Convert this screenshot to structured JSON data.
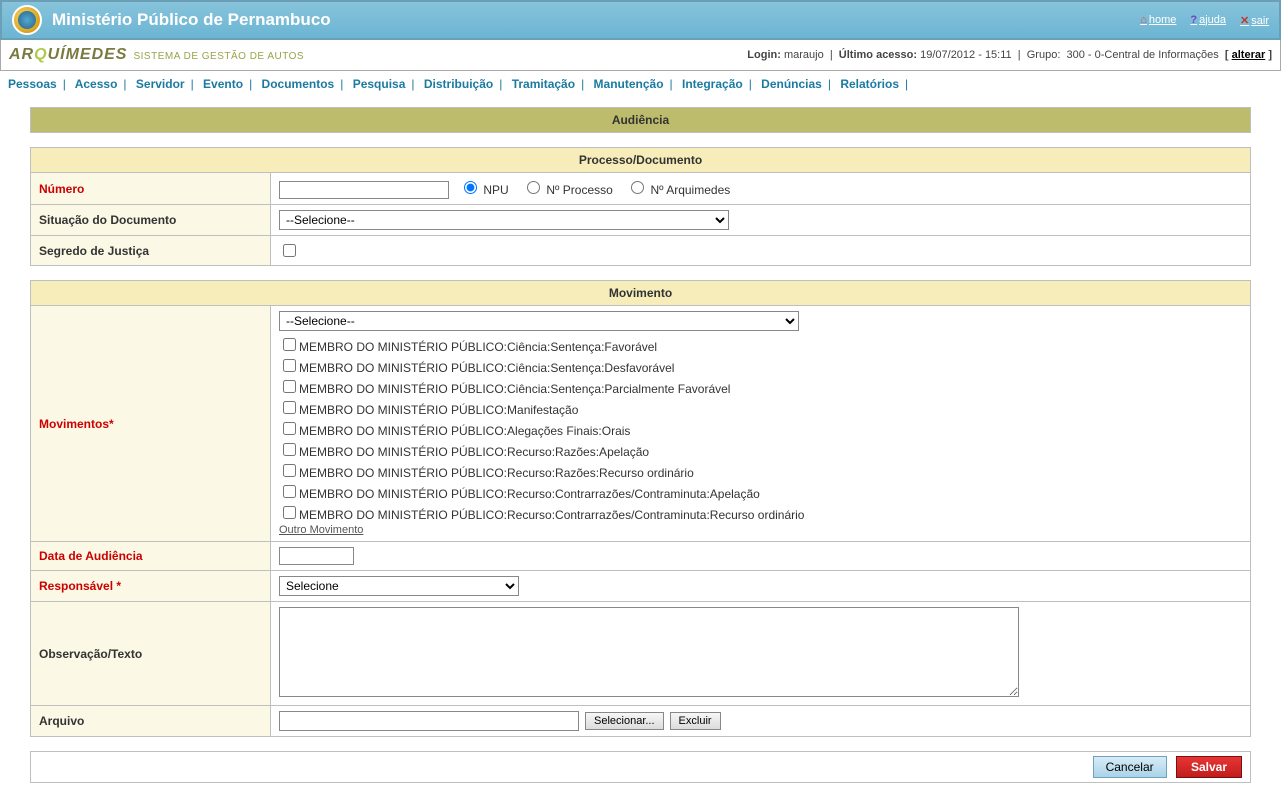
{
  "header": {
    "title": "Ministério Público de Pernambuco",
    "links": {
      "home": "home",
      "ajuda": "ajuda",
      "sair": "sair"
    }
  },
  "brand": {
    "name_pre": "AR",
    "name_accent": "Q",
    "name_post": "UÍMEDES",
    "sub": "SISTEMA DE GESTÃO DE AUTOS"
  },
  "loginbar": {
    "login_label": "Login:",
    "login_user": "maraujo",
    "acesso_label": "Último acesso:",
    "acesso_val": "19/07/2012 - 15:11",
    "grupo_label": "Grupo:",
    "grupo_val": "300 - 0-Central de Informações",
    "alterar": "alterar"
  },
  "menu": [
    "Pessoas",
    "Acesso",
    "Servidor",
    "Evento",
    "Documentos",
    "Pesquisa",
    "Distribuição",
    "Tramitação",
    "Manutenção",
    "Integração",
    "Denúncias",
    "Relatórios"
  ],
  "form": {
    "title": "Audiência",
    "section1": "Processo/Documento",
    "numero_label": "Número",
    "radio_opts": [
      "NPU",
      "Nº Processo",
      "Nº Arquimedes"
    ],
    "situacao_label": "Situação do Documento",
    "situacao_placeholder": "--Selecione--",
    "segredo_label": "Segredo de Justiça",
    "section2": "Movimento",
    "movimentos_label": "Movimentos*",
    "mov_select_placeholder": "--Selecione--",
    "mov_items": [
      "MEMBRO DO MINISTÉRIO PÚBLICO:Ciência:Sentença:Favorável",
      "MEMBRO DO MINISTÉRIO PÚBLICO:Ciência:Sentença:Desfavorável",
      "MEMBRO DO MINISTÉRIO PÚBLICO:Ciência:Sentença:Parcialmente Favorável",
      "MEMBRO DO MINISTÉRIO PÚBLICO:Manifestação",
      "MEMBRO DO MINISTÉRIO PÚBLICO:Alegações Finais:Orais",
      "MEMBRO DO MINISTÉRIO PÚBLICO:Recurso:Razões:Apelação",
      "MEMBRO DO MINISTÉRIO PÚBLICO:Recurso:Razões:Recurso ordinário",
      "MEMBRO DO MINISTÉRIO PÚBLICO:Recurso:Contrarrazões/Contraminuta:Apelação",
      "MEMBRO DO MINISTÉRIO PÚBLICO:Recurso:Contrarrazões/Contraminuta:Recurso ordinário"
    ],
    "outro_mov": "Outro Movimento",
    "data_audiencia_label": "Data de Audiência",
    "responsavel_label": "Responsável *",
    "responsavel_placeholder": "Selecione",
    "observacao_label": "Observação/Texto",
    "arquivo_label": "Arquivo",
    "btn_selecionar": "Selecionar...",
    "btn_excluir": "Excluir",
    "btn_cancelar": "Cancelar",
    "btn_salvar": "Salvar"
  }
}
